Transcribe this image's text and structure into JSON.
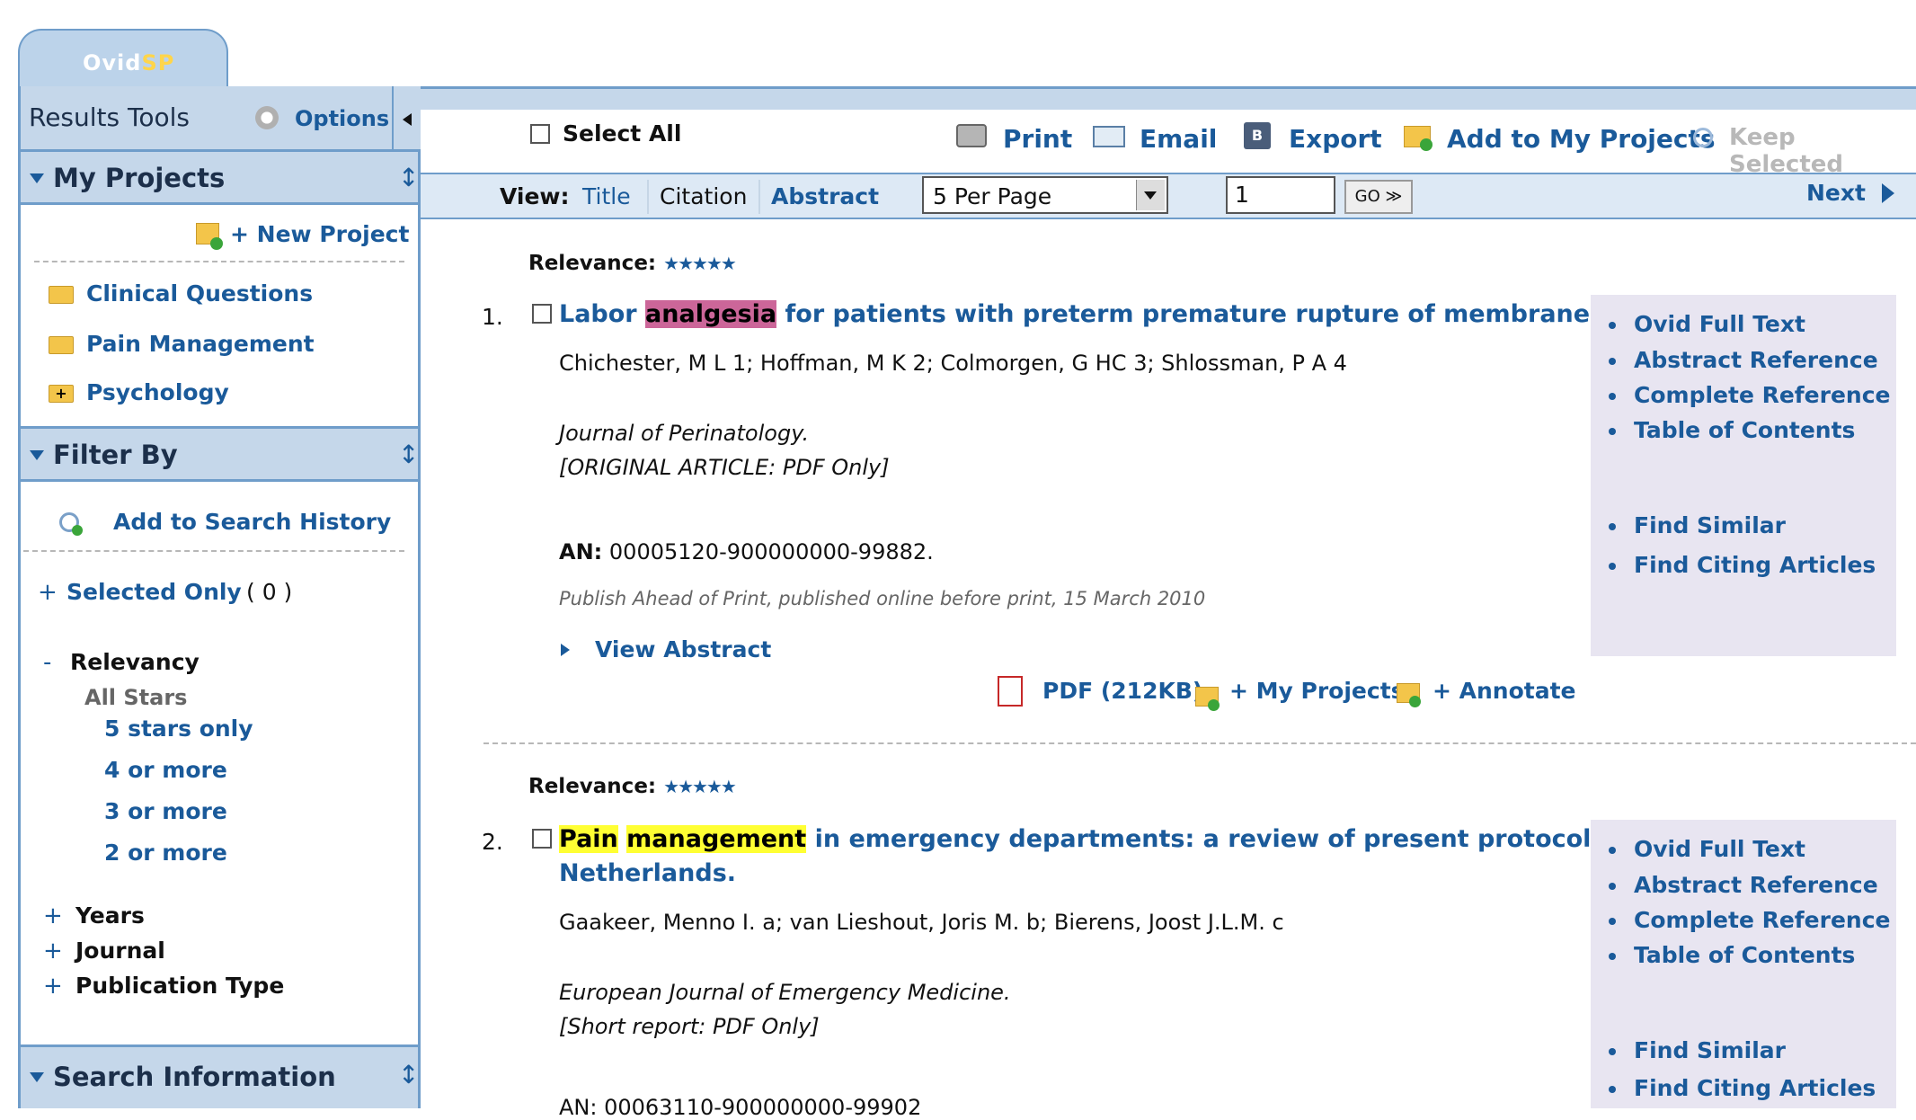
{
  "app": {
    "tab_part1": "Ovid",
    "tab_part2": "SP"
  },
  "sidebar": {
    "results_tools": "Results Tools",
    "options": "Options",
    "my_projects": {
      "header": "My Projects",
      "new_project": "+ New Project",
      "items": [
        "Clinical Questions",
        "Pain Management",
        "Psychology"
      ]
    },
    "filter_by": {
      "header": "Filter By",
      "add_history": "Add to Search History",
      "selected_only": "Selected Only",
      "selected_count": "( 0 )",
      "relevancy": "Relevancy",
      "all_stars": "All Stars",
      "star_options": [
        "5 stars only",
        "4 or more",
        "3 or more",
        "2 or more"
      ],
      "collapsed": [
        "Years",
        "Journal",
        "Publication Type"
      ]
    },
    "search_information": "Search Information"
  },
  "toolbar": {
    "select_all": "Select All",
    "print": "Print",
    "email": "Email",
    "export": "Export",
    "add_projects": "Add to My Projects",
    "keep_selected": "Keep Selected"
  },
  "viewbar": {
    "view_label": "View:",
    "title": "Title",
    "citation": "Citation",
    "abstract": "Abstract",
    "per_page": "5 Per Page",
    "page_value": "1",
    "go": "GO",
    "next": "Next"
  },
  "results": [
    {
      "relevance_label": "Relevance:",
      "stars": "★★★★★",
      "number": "1.",
      "title_pre": "Labor ",
      "title_hl1": "analgesia",
      "title_post": " for patients with preterm premature rupture of membranes.",
      "authors": "Chichester, M L 1; Hoffman, M K 2; Colmorgen, G HC 3; Shlossman, P A 4",
      "journal": "Journal of Perinatology.",
      "article_type": "[ORIGINAL ARTICLE: PDF Only]",
      "an_label": "AN:",
      "an_value": "00005120-900000000-99882.",
      "publish_note": "Publish Ahead of Print, published online before print, 15 March 2010",
      "view_abstract": "View Abstract",
      "pdf": "PDF (212KB)",
      "my_projects": "+ My Projects",
      "annotate": "+ Annotate",
      "links": [
        "Ovid Full Text",
        "Abstract Reference",
        "Complete Reference",
        "Table of Contents",
        "Find Similar",
        "Find Citing Articles"
      ]
    },
    {
      "relevance_label": "Relevance:",
      "stars": "★★★★★",
      "number": "2.",
      "title_hl1": "Pain",
      "title_hl2": "management",
      "title_line1_post": " in emergency departments: a review of present protocols in The",
      "title_line2": "Netherlands.",
      "authors": "Gaakeer, Menno I. a; van Lieshout, Joris M. b; Bierens, Joost J.L.M. c",
      "journal": "European Journal of Emergency Medicine.",
      "article_type": "[Short report: PDF Only]",
      "an_partial": "AN: 00063110-900000000-99902",
      "links": [
        "Ovid Full Text",
        "Abstract Reference",
        "Complete Reference",
        "Table of Contents",
        "Find Similar",
        "Find Citing Articles"
      ]
    }
  ]
}
